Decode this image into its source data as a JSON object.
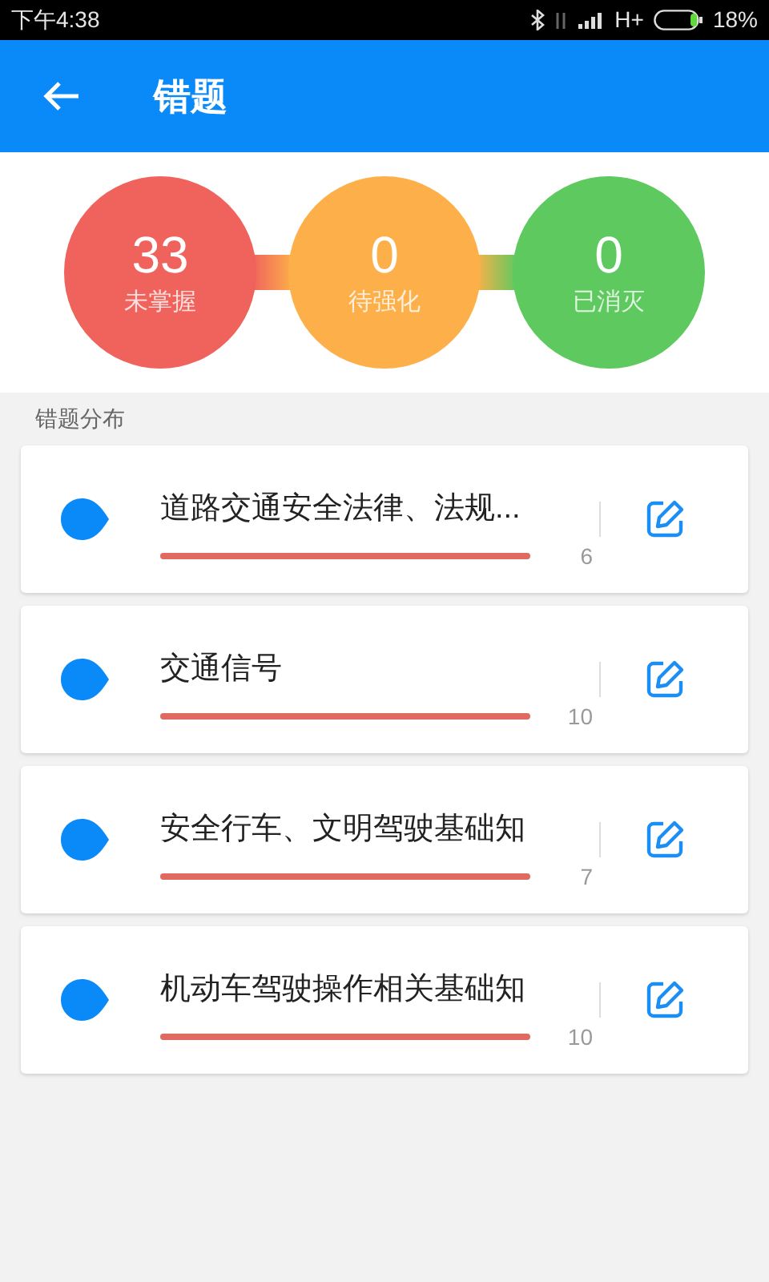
{
  "status_bar": {
    "time": "下午4:38",
    "network": "H+",
    "battery": "18%"
  },
  "app_bar": {
    "title": "错题"
  },
  "stats": [
    {
      "value": "33",
      "label": "未掌握",
      "color": "#f0625c"
    },
    {
      "value": "0",
      "label": "待强化",
      "color": "#fdb04a"
    },
    {
      "value": "0",
      "label": "已消灭",
      "color": "#5ec95e"
    }
  ],
  "section_title": "错题分布",
  "categories": [
    {
      "title": "道路交通安全法律、法规...",
      "count": "6"
    },
    {
      "title": "交通信号",
      "count": "10"
    },
    {
      "title": "安全行车、文明驾驶基础知",
      "count": "7"
    },
    {
      "title": "机动车驾驶操作相关基础知",
      "count": "10"
    }
  ]
}
